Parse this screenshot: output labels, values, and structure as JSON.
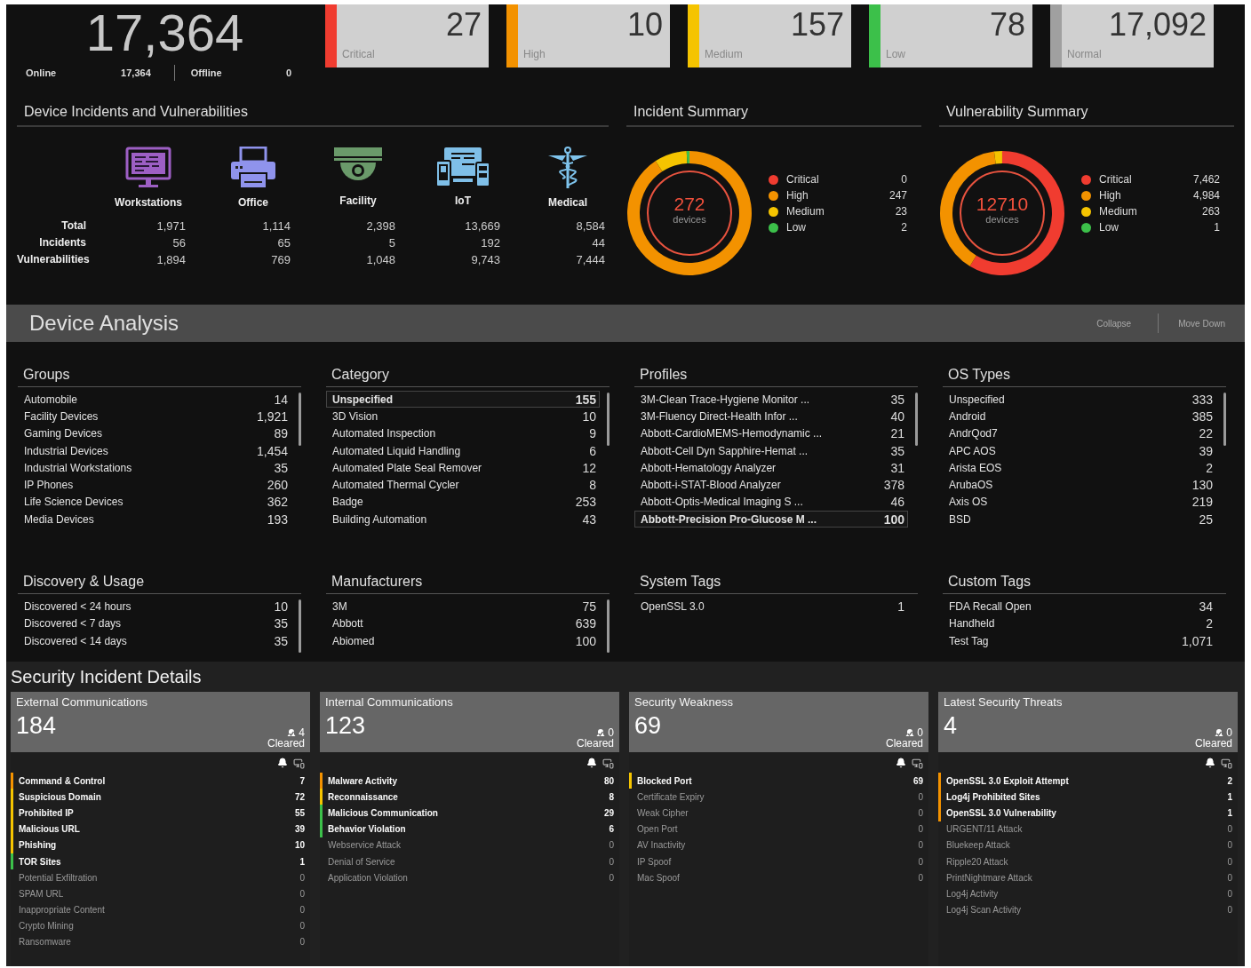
{
  "summary_bar": {
    "total": "17,364",
    "online_label": "Online",
    "online": "17,364",
    "offline_label": "Offline",
    "offline": "0"
  },
  "severity_cards": [
    {
      "count": "27",
      "label": "Critical",
      "color": "#f03c30"
    },
    {
      "count": "10",
      "label": "High",
      "color": "#f39200"
    },
    {
      "count": "157",
      "label": "Medium",
      "color": "#f5c400"
    },
    {
      "count": "78",
      "label": "Low",
      "color": "#3cc04a"
    },
    {
      "count": "17,092",
      "label": "Normal",
      "color": "#a0a0a0"
    }
  ],
  "device_panel": {
    "title": "Device Incidents and Vulnerabilities",
    "row_labels": [
      "Total",
      "Incidents",
      "Vulnerabilities"
    ],
    "devices": [
      {
        "kind": "workstation",
        "label": "Workstations",
        "values": [
          "1,971",
          "56",
          "1,894"
        ]
      },
      {
        "kind": "office",
        "label": "Office",
        "values": [
          "1,114",
          "65",
          "769"
        ]
      },
      {
        "kind": "facility",
        "label": "Facility",
        "values": [
          "2,398",
          "5",
          "1,048"
        ]
      },
      {
        "kind": "iot",
        "label": "IoT",
        "values": [
          "13,669",
          "192",
          "9,743"
        ]
      },
      {
        "kind": "medical",
        "label": "Medical",
        "values": [
          "8,584",
          "44",
          "7,444"
        ]
      }
    ]
  },
  "summaries": [
    {
      "title": "Incident Summary",
      "total": "272",
      "unit": "devices",
      "legend": [
        {
          "label": "Critical",
          "value": "0",
          "color": "#f03c30"
        },
        {
          "label": "High",
          "value": "247",
          "color": "#f39200"
        },
        {
          "label": "Medium",
          "value": "23",
          "color": "#f5c400"
        },
        {
          "label": "Low",
          "value": "2",
          "color": "#3cc04a"
        }
      ]
    },
    {
      "title": "Vulnerability Summary",
      "total": "12710",
      "unit": "devices",
      "legend": [
        {
          "label": "Critical",
          "value": "7,462",
          "color": "#f03c30"
        },
        {
          "label": "High",
          "value": "4,984",
          "color": "#f39200"
        },
        {
          "label": "Medium",
          "value": "263",
          "color": "#f5c400"
        },
        {
          "label": "Low",
          "value": "1",
          "color": "#3cc04a"
        }
      ]
    }
  ],
  "device_analysis": {
    "title": "Device Analysis",
    "actions": [
      "Collapse",
      "Move Down"
    ]
  },
  "lists": [
    {
      "title": "Groups",
      "scrollbar": true,
      "items": [
        {
          "label": "Automobile",
          "count": "14",
          "selected": false
        },
        {
          "label": "Facility Devices",
          "count": "1,921",
          "selected": false
        },
        {
          "label": "Gaming Devices",
          "count": "89",
          "selected": false
        },
        {
          "label": "Industrial Devices",
          "count": "1,454",
          "selected": false
        },
        {
          "label": "Industrial Workstations",
          "count": "35",
          "selected": false
        },
        {
          "label": "IP Phones",
          "count": "260",
          "selected": false
        },
        {
          "label": "Life Science Devices",
          "count": "362",
          "selected": false
        },
        {
          "label": "Media Devices",
          "count": "193",
          "selected": false
        }
      ]
    },
    {
      "title": "Category",
      "scrollbar": true,
      "items": [
        {
          "label": "Unspecified",
          "count": "155",
          "selected": true
        },
        {
          "label": "3D Vision",
          "count": "10",
          "selected": false
        },
        {
          "label": "Automated Inspection",
          "count": "9",
          "selected": false
        },
        {
          "label": "Automated Liquid Handling",
          "count": "6",
          "selected": false
        },
        {
          "label": "Automated Plate Seal Remover",
          "count": "12",
          "selected": false
        },
        {
          "label": "Automated Thermal Cycler",
          "count": "8",
          "selected": false
        },
        {
          "label": "Badge",
          "count": "253",
          "selected": false
        },
        {
          "label": "Building Automation",
          "count": "43",
          "selected": false
        }
      ]
    },
    {
      "title": "Profiles",
      "scrollbar": true,
      "items": [
        {
          "label": "3M-Clean Trace-Hygiene Monitor ...",
          "count": "35",
          "selected": false
        },
        {
          "label": "3M-Fluency Direct-Health Infor ...",
          "count": "40",
          "selected": false
        },
        {
          "label": "Abbott-CardioMEMS-Hemodynamic ...",
          "count": "21",
          "selected": false
        },
        {
          "label": "Abbott-Cell Dyn Sapphire-Hemat ...",
          "count": "35",
          "selected": false
        },
        {
          "label": "Abbott-Hematology Analyzer",
          "count": "31",
          "selected": false
        },
        {
          "label": "Abbott-i-STAT-Blood Analyzer",
          "count": "378",
          "selected": false
        },
        {
          "label": "Abbott-Optis-Medical Imaging S ...",
          "count": "46",
          "selected": false
        },
        {
          "label": "Abbott-Precision Pro-Glucose M ...",
          "count": "100",
          "selected": true
        }
      ]
    },
    {
      "title": "OS Types",
      "scrollbar": true,
      "items": [
        {
          "label": "Unspecified",
          "count": "333",
          "selected": false
        },
        {
          "label": "Android",
          "count": "385",
          "selected": false
        },
        {
          "label": "AndrQod7",
          "count": "22",
          "selected": false
        },
        {
          "label": "APC AOS",
          "count": "39",
          "selected": false
        },
        {
          "label": "Arista EOS",
          "count": "2",
          "selected": false
        },
        {
          "label": "ArubaOS",
          "count": "130",
          "selected": false
        },
        {
          "label": "Axis OS",
          "count": "219",
          "selected": false
        },
        {
          "label": "BSD",
          "count": "25",
          "selected": false
        }
      ]
    },
    {
      "title": "Discovery & Usage",
      "scrollbar": true,
      "items": [
        {
          "label": "Discovered < 24 hours",
          "count": "10",
          "selected": false
        },
        {
          "label": "Discovered < 7 days",
          "count": "35",
          "selected": false
        },
        {
          "label": "Discovered < 14 days",
          "count": "35",
          "selected": false
        }
      ]
    },
    {
      "title": "Manufacturers",
      "scrollbar": true,
      "items": [
        {
          "label": "3M",
          "count": "75",
          "selected": false
        },
        {
          "label": "Abbott",
          "count": "639",
          "selected": false
        },
        {
          "label": "Abiomed",
          "count": "100",
          "selected": false
        }
      ]
    },
    {
      "title": "System Tags",
      "scrollbar": false,
      "items": [
        {
          "label": "OpenSSL 3.0",
          "count": "1",
          "selected": false
        }
      ]
    },
    {
      "title": "Custom Tags",
      "scrollbar": false,
      "items": [
        {
          "label": "FDA Recall Open",
          "count": "34",
          "selected": false
        },
        {
          "label": "Handheld",
          "count": "2",
          "selected": false
        },
        {
          "label": "Test Tag",
          "count": "1,071",
          "selected": false
        }
      ]
    }
  ],
  "security": {
    "title": "Security Incident Details",
    "cards": [
      {
        "title": "External Communications",
        "count": "184",
        "cleared": "4",
        "cleared_label": "Cleared",
        "items": [
          {
            "label": "Command & Control",
            "count": "7",
            "color": "#f39200"
          },
          {
            "label": "Suspicious Domain",
            "count": "72",
            "color": "#f5c400"
          },
          {
            "label": "Prohibited IP",
            "count": "55",
            "color": "#f5c400"
          },
          {
            "label": "Malicious URL",
            "count": "39",
            "color": "#f5c400"
          },
          {
            "label": "Phishing",
            "count": "10",
            "color": "#f5c400"
          },
          {
            "label": "TOR Sites",
            "count": "1",
            "color": "#3cc04a"
          },
          {
            "label": "Potential Exfiltration",
            "count": "0"
          },
          {
            "label": "SPAM URL",
            "count": "0"
          },
          {
            "label": "Inappropriate Content",
            "count": "0"
          },
          {
            "label": "Crypto Mining",
            "count": "0"
          },
          {
            "label": "Ransomware",
            "count": "0"
          }
        ]
      },
      {
        "title": "Internal Communications",
        "count": "123",
        "cleared": "0",
        "cleared_label": "Cleared",
        "items": [
          {
            "label": "Malware Activity",
            "count": "80",
            "color": "#f39200"
          },
          {
            "label": "Reconnaissance",
            "count": "8",
            "color": "#f5c400"
          },
          {
            "label": "Malicious Communication",
            "count": "29",
            "color": "#3cc04a"
          },
          {
            "label": "Behavior Violation",
            "count": "6",
            "color": "#3cc04a"
          },
          {
            "label": "Webservice Attack",
            "count": "0"
          },
          {
            "label": "Denial of Service",
            "count": "0"
          },
          {
            "label": "Application Violation",
            "count": "0"
          }
        ]
      },
      {
        "title": "Security Weakness",
        "count": "69",
        "cleared": "0",
        "cleared_label": "Cleared",
        "items": [
          {
            "label": "Blocked Port",
            "count": "69",
            "color": "#f5c400"
          },
          {
            "label": "Certificate Expiry",
            "count": "0"
          },
          {
            "label": "Weak Cipher",
            "count": "0"
          },
          {
            "label": "Open Port",
            "count": "0"
          },
          {
            "label": "AV Inactivity",
            "count": "0"
          },
          {
            "label": "IP Spoof",
            "count": "0"
          },
          {
            "label": "Mac Spoof",
            "count": "0"
          }
        ]
      },
      {
        "title": "Latest Security Threats",
        "count": "4",
        "cleared": "0",
        "cleared_label": "Cleared",
        "items": [
          {
            "label": "OpenSSL 3.0 Exploit Attempt",
            "count": "2",
            "color": "#f39200"
          },
          {
            "label": "Log4j Prohibited Sites",
            "count": "1",
            "color": "#f39200"
          },
          {
            "label": "OpenSSL 3.0 Vulnerability",
            "count": "1",
            "color": "#f39200"
          },
          {
            "label": "URGENT/11 Attack",
            "count": "0"
          },
          {
            "label": "Bluekeep Attack",
            "count": "0"
          },
          {
            "label": "Ripple20 Attack",
            "count": "0"
          },
          {
            "label": "PrintNightmare Attack",
            "count": "0"
          },
          {
            "label": "Log4j Activity",
            "count": "0"
          },
          {
            "label": "Log4j Scan Activity",
            "count": "0"
          }
        ]
      }
    ]
  }
}
